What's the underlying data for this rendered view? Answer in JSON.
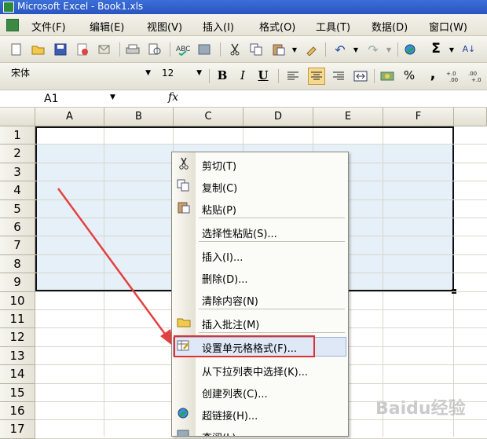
{
  "window": {
    "title": "Microsoft Excel - Book1.xls"
  },
  "menubar": {
    "items": [
      "文件(F)",
      "编辑(E)",
      "视图(V)",
      "插入(I)",
      "格式(O)",
      "工具(T)",
      "数据(D)",
      "窗口(W)"
    ]
  },
  "format_toolbar": {
    "font_name": "宋体",
    "font_size": "12",
    "bold": "B",
    "italic": "I",
    "underline": "U",
    "percent": "%",
    "comma": ",",
    "inc_decimal": "+.0\n.00",
    "dec_decimal": ".00\n+.0"
  },
  "standard_toolbar": {
    "sum": "Σ",
    "sort": "A↓"
  },
  "formula_bar": {
    "name_box": "A1",
    "fx": "fx"
  },
  "sheet": {
    "columns": [
      "A",
      "B",
      "C",
      "D",
      "E",
      "F"
    ],
    "rows": [
      "1",
      "2",
      "3",
      "4",
      "5",
      "6",
      "7",
      "8",
      "9",
      "10",
      "11",
      "12",
      "13",
      "14",
      "15",
      "16",
      "17"
    ]
  },
  "context_menu": {
    "items": [
      {
        "label": "剪切(T)",
        "icon": "scissors-icon"
      },
      {
        "label": "复制(C)",
        "icon": "copy-icon"
      },
      {
        "label": "粘贴(P)",
        "icon": "paste-icon"
      },
      {
        "label": "选择性粘贴(S)...",
        "icon": ""
      },
      {
        "label": "插入(I)...",
        "icon": ""
      },
      {
        "label": "删除(D)...",
        "icon": ""
      },
      {
        "label": "清除内容(N)",
        "icon": ""
      },
      {
        "label": "插入批注(M)",
        "icon": "folder-icon"
      },
      {
        "label": "设置单元格格式(F)...",
        "icon": "format-cells-icon",
        "highlighted": true
      },
      {
        "label": "从下拉列表中选择(K)...",
        "icon": ""
      },
      {
        "label": "创建列表(C)...",
        "icon": ""
      },
      {
        "label": "超链接(H)...",
        "icon": "hyperlink-icon"
      },
      {
        "label": "查阅(L)...",
        "icon": "research-icon"
      }
    ]
  },
  "watermark": {
    "text": "Baidu经验"
  },
  "colors": {
    "selection": "#e6f0f8",
    "highlight_border": "#e23030",
    "arrow": "#e54040"
  }
}
